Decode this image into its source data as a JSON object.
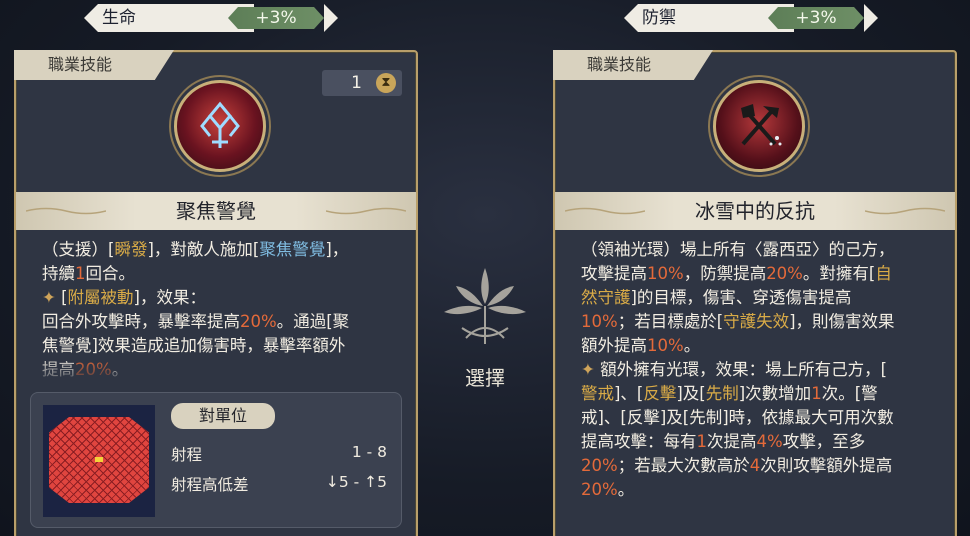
{
  "stats": {
    "left": {
      "name": "生命",
      "value": "+3%"
    },
    "right": {
      "name": "防禦",
      "value": "+3%"
    }
  },
  "left_card": {
    "tag": "職業技能",
    "cost": "1",
    "skill_name": "聚焦警覺",
    "desc_line1_a": "（支援）[",
    "desc_line1_hl": "瞬發",
    "desc_line1_b": "]，對敵人施加[",
    "desc_line1_blue": "聚焦警覺",
    "desc_line1_c": "]，",
    "desc_line2_a": "持續",
    "desc_line2_num": "1",
    "desc_line2_b": "回合。",
    "desc_line3_a": "[",
    "desc_line3_hl": "附屬被動",
    "desc_line3_b": "]，效果：",
    "desc_line4_a": "回合外攻擊時，暴擊率提高",
    "desc_line4_num": "20%",
    "desc_line4_b": "。通過[聚",
    "desc_line5": "焦警覺]效果造成追加傷害時，暴擊率額外",
    "desc_line6_a": "提高",
    "desc_line6_num": "20%",
    "desc_line6_b": "。",
    "range": {
      "title": "對單位",
      "row1_label": "射程",
      "row1_value": "1 - 8",
      "row2_label": "射程高低差",
      "row2_value": "↓5 - ↑5"
    }
  },
  "center": {
    "label": "選擇"
  },
  "right_card": {
    "tag": "職業技能",
    "skill_name": "冰雪中的反抗",
    "l1": "（領袖光環）場上所有〈露西亞〉的己方，",
    "l2_a": "攻擊提高",
    "l2_n1": "10%",
    "l2_b": "，防禦提高",
    "l2_n2": "20%",
    "l2_c": "。對擁有[",
    "l2_hl": "自",
    "l3_hl": "然守護",
    "l3_b": "]的目標，傷害、穿透傷害提高",
    "l4_n": "10%",
    "l4_a": "；若目標處於[",
    "l4_hl": "守護失效",
    "l4_b": "]，則傷害效果",
    "l5_a": "額外提高",
    "l5_n": "10%",
    "l5_b": "。",
    "l6": "額外擁有光環，效果：場上所有己方，[",
    "l7_hl1": "警戒",
    "l7_a": "]、[",
    "l7_hl2": "反擊",
    "l7_b": "]及[",
    "l7_hl3": "先制",
    "l7_c": "]次數增加",
    "l7_n": "1",
    "l7_d": "次。[警",
    "l8_a": "戒]、[反擊]及[先制]時，依據最大可用次數",
    "l9_a": "提高攻擊：每有",
    "l9_n1": "1",
    "l9_b": "次提高",
    "l9_n2": "4%",
    "l9_c": "攻擊，至多",
    "l10_n": "20%",
    "l10_a": "；若最大次數高於",
    "l10_n2": "4",
    "l10_b": "次則攻擊額外提高",
    "l11_n": "20%",
    "l11_a": "。"
  }
}
